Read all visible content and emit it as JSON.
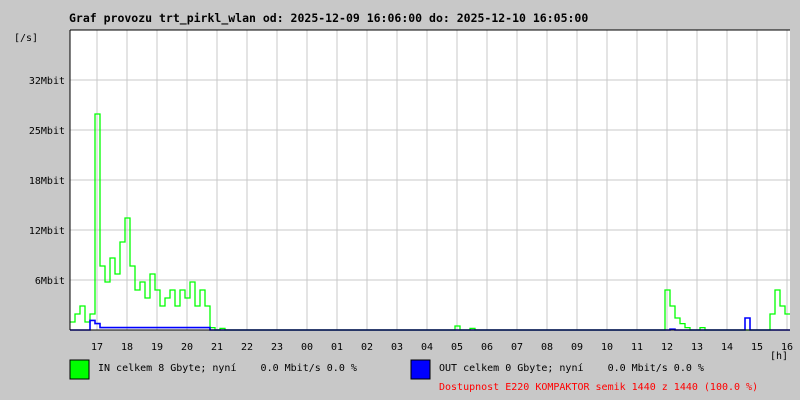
{
  "chart_data": {
    "type": "area",
    "title": "Graf provozu trt_pirkl_wlan od: 2025-12-09 16:06:00 do: 2025-12-10 16:05:00",
    "ylabel": "[/s]",
    "xlabel": "[h]",
    "ylim": [
      0,
      37.5
    ],
    "y_unit": "Mbit/s",
    "yticks": [
      {
        "value": 6.25,
        "label": "6Mbit"
      },
      {
        "value": 12.5,
        "label": "12Mbit"
      },
      {
        "value": 18.75,
        "label": "18Mbit"
      },
      {
        "value": 25,
        "label": "25Mbit"
      },
      {
        "value": 31.25,
        "label": "32Mbit"
      }
    ],
    "xrange_minutes": [
      0,
      1440
    ],
    "x_start_label": "16:06",
    "sample_interval_minutes": 10,
    "xticks": [
      {
        "minute": 54,
        "label": "17"
      },
      {
        "minute": 114,
        "label": "18"
      },
      {
        "minute": 174,
        "label": "19"
      },
      {
        "minute": 234,
        "label": "20"
      },
      {
        "minute": 294,
        "label": "21"
      },
      {
        "minute": 354,
        "label": "22"
      },
      {
        "minute": 414,
        "label": "23"
      },
      {
        "minute": 474,
        "label": "00"
      },
      {
        "minute": 534,
        "label": "01"
      },
      {
        "minute": 594,
        "label": "02"
      },
      {
        "minute": 654,
        "label": "03"
      },
      {
        "minute": 714,
        "label": "04"
      },
      {
        "minute": 774,
        "label": "05"
      },
      {
        "minute": 834,
        "label": "06"
      },
      {
        "minute": 894,
        "label": "07"
      },
      {
        "minute": 954,
        "label": "08"
      },
      {
        "minute": 1014,
        "label": "09"
      },
      {
        "minute": 1074,
        "label": "10"
      },
      {
        "minute": 1134,
        "label": "11"
      },
      {
        "minute": 1194,
        "label": "12"
      },
      {
        "minute": 1254,
        "label": "13"
      },
      {
        "minute": 1314,
        "label": "14"
      },
      {
        "minute": 1374,
        "label": "15"
      },
      {
        "minute": 1434,
        "label": "16"
      }
    ],
    "grid": true,
    "series": [
      {
        "name": "IN",
        "color": "#00ff00",
        "values": [
          1,
          2,
          3,
          1,
          2,
          27,
          8,
          6,
          9,
          7,
          11,
          14,
          8,
          5,
          6,
          4,
          7,
          5,
          3,
          4,
          5,
          3,
          5,
          4,
          6,
          3,
          5,
          3,
          0.3,
          0,
          0.2,
          0,
          0,
          0,
          0,
          0,
          0,
          0,
          0,
          0,
          0,
          0,
          0,
          0,
          0,
          0,
          0,
          0,
          0,
          0,
          0,
          0,
          0,
          0,
          0,
          0,
          0,
          0,
          0,
          0,
          0,
          0,
          0,
          0,
          0,
          0,
          0,
          0,
          0,
          0,
          0,
          0,
          0,
          0,
          0,
          0,
          0,
          0.5,
          0,
          0,
          0.2,
          0,
          0,
          0,
          0,
          0,
          0,
          0,
          0,
          0,
          0,
          0,
          0,
          0,
          0,
          0,
          0,
          0,
          0,
          0,
          0,
          0,
          0,
          0,
          0,
          0,
          0,
          0,
          0,
          0,
          0,
          0,
          0,
          0,
          0,
          0,
          0,
          0,
          0,
          5,
          3,
          1.5,
          0.8,
          0.3,
          0,
          0,
          0.3,
          0,
          0,
          0,
          0,
          0,
          0,
          0,
          0,
          0,
          0,
          0,
          0,
          0,
          2,
          5,
          3,
          2
        ]
      },
      {
        "name": "OUT",
        "color": "#0000ff",
        "values": [
          0,
          0,
          0,
          0,
          1.2,
          0.8,
          0.3,
          0.3,
          0.3,
          0.3,
          0.3,
          0.3,
          0.3,
          0.3,
          0.3,
          0.3,
          0.3,
          0.3,
          0.3,
          0.3,
          0.3,
          0.3,
          0.3,
          0.3,
          0.3,
          0.3,
          0.3,
          0.3,
          0,
          0,
          0,
          0,
          0,
          0,
          0,
          0,
          0,
          0,
          0,
          0,
          0,
          0,
          0,
          0,
          0,
          0,
          0,
          0,
          0,
          0,
          0,
          0,
          0,
          0,
          0,
          0,
          0,
          0,
          0,
          0,
          0,
          0,
          0,
          0,
          0,
          0,
          0,
          0,
          0,
          0,
          0,
          0,
          0,
          0,
          0,
          0,
          0,
          0,
          0,
          0,
          0,
          0,
          0,
          0,
          0,
          0,
          0,
          0,
          0,
          0,
          0,
          0,
          0,
          0,
          0,
          0,
          0,
          0,
          0,
          0,
          0,
          0,
          0,
          0,
          0,
          0,
          0,
          0,
          0,
          0,
          0,
          0,
          0,
          0,
          0,
          0,
          0,
          0,
          0,
          0,
          0.1,
          0,
          0,
          0,
          0,
          0,
          0,
          0,
          0,
          0,
          0,
          0,
          0,
          0,
          0,
          1.5,
          0,
          0,
          0,
          0,
          0,
          0,
          0,
          0
        ]
      }
    ]
  },
  "legend": {
    "in_text": "IN celkem 8 Gbyte; nyní    0.0 Mbit/s 0.0 %",
    "in_color": "#00ff00",
    "out_text": "OUT celkem 0 Gbyte; nyní    0.0 Mbit/s 0.0 %",
    "out_color": "#0000ff",
    "availability": "Dostupnost E220 KOMPAKTOR semik 1440 z 1440 (100.0 %)"
  }
}
